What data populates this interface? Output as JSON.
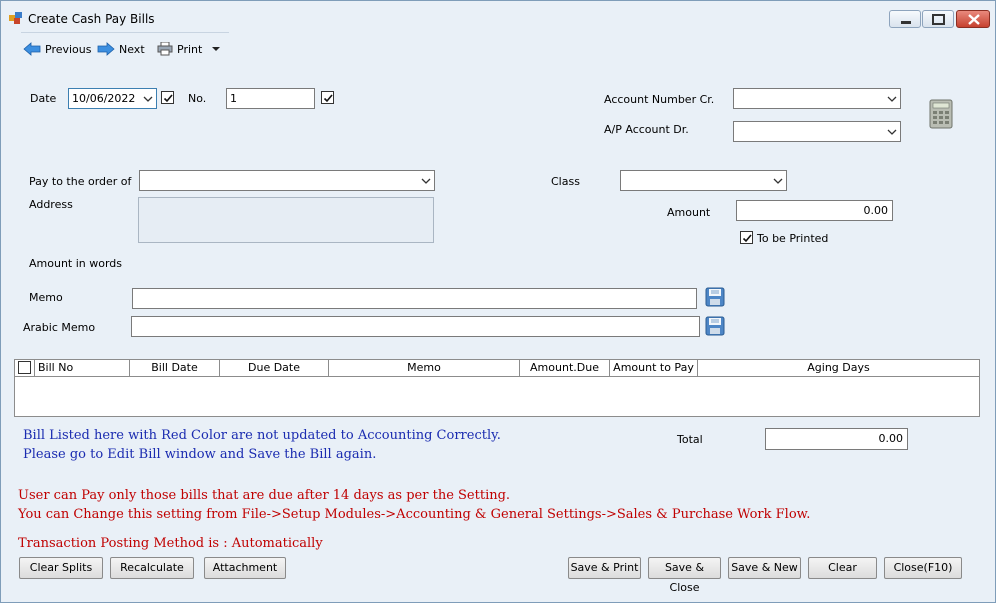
{
  "window": {
    "title": "Create Cash Pay Bills",
    "icon": "app-window-icon",
    "controls": [
      "minimize-icon",
      "maximize-icon",
      "close-icon"
    ]
  },
  "toolbar": {
    "previous_label": "Previous",
    "next_label": "Next",
    "print_label": "Print"
  },
  "form": {
    "date_label": "Date",
    "date_value": "10/06/2022",
    "no_label": "No.",
    "no_value": "1",
    "account_cr_label": "Account Number Cr.",
    "account_cr_value": "",
    "ap_account_label": "A/P Account Dr.",
    "ap_account_value": "",
    "pay_to_label": "Pay to the order of",
    "pay_to_value": "",
    "address_label": "Address",
    "class_label": "Class",
    "class_value": "",
    "amount_label": "Amount",
    "amount_value": "0.00",
    "to_be_printed_label": "To be Printed",
    "amount_words_label": "Amount in words",
    "memo_label": "Memo",
    "memo_value": "",
    "arabic_memo_label": "Arabic Memo",
    "arabic_memo_value": ""
  },
  "grid": {
    "columns": [
      "Bill No",
      "Bill Date",
      "Due Date",
      "Memo",
      "Amount.Due",
      "Amount to Pay",
      "Aging Days"
    ],
    "rows": []
  },
  "total": {
    "label": "Total",
    "value": "0.00"
  },
  "notes": {
    "blue_1": "Bill Listed here with Red Color are not updated to Accounting Correctly.",
    "blue_2": "Please go to Edit Bill window and Save the Bill again.",
    "red_1": "User can Pay only those bills that are due after 14 days as per the Setting.",
    "red_2": "You can Change this setting from File->Setup Modules->Accounting & General Settings->Sales & Purchase Work Flow.",
    "posting": "Transaction Posting Method is : Automatically"
  },
  "buttons": {
    "clear_splits": "Clear Splits",
    "recalculate": "Recalculate",
    "attachment": "Attachment",
    "save_print": "Save & Print",
    "save_close": "Save & Close",
    "save_new": "Save & New",
    "clear": "Clear",
    "close": "Close(F10)"
  },
  "colors": {
    "window_bg": "#e9f0f7",
    "note_blue": "#1a2bb0",
    "note_red": "#c00000",
    "close_button": "#c6412f"
  }
}
